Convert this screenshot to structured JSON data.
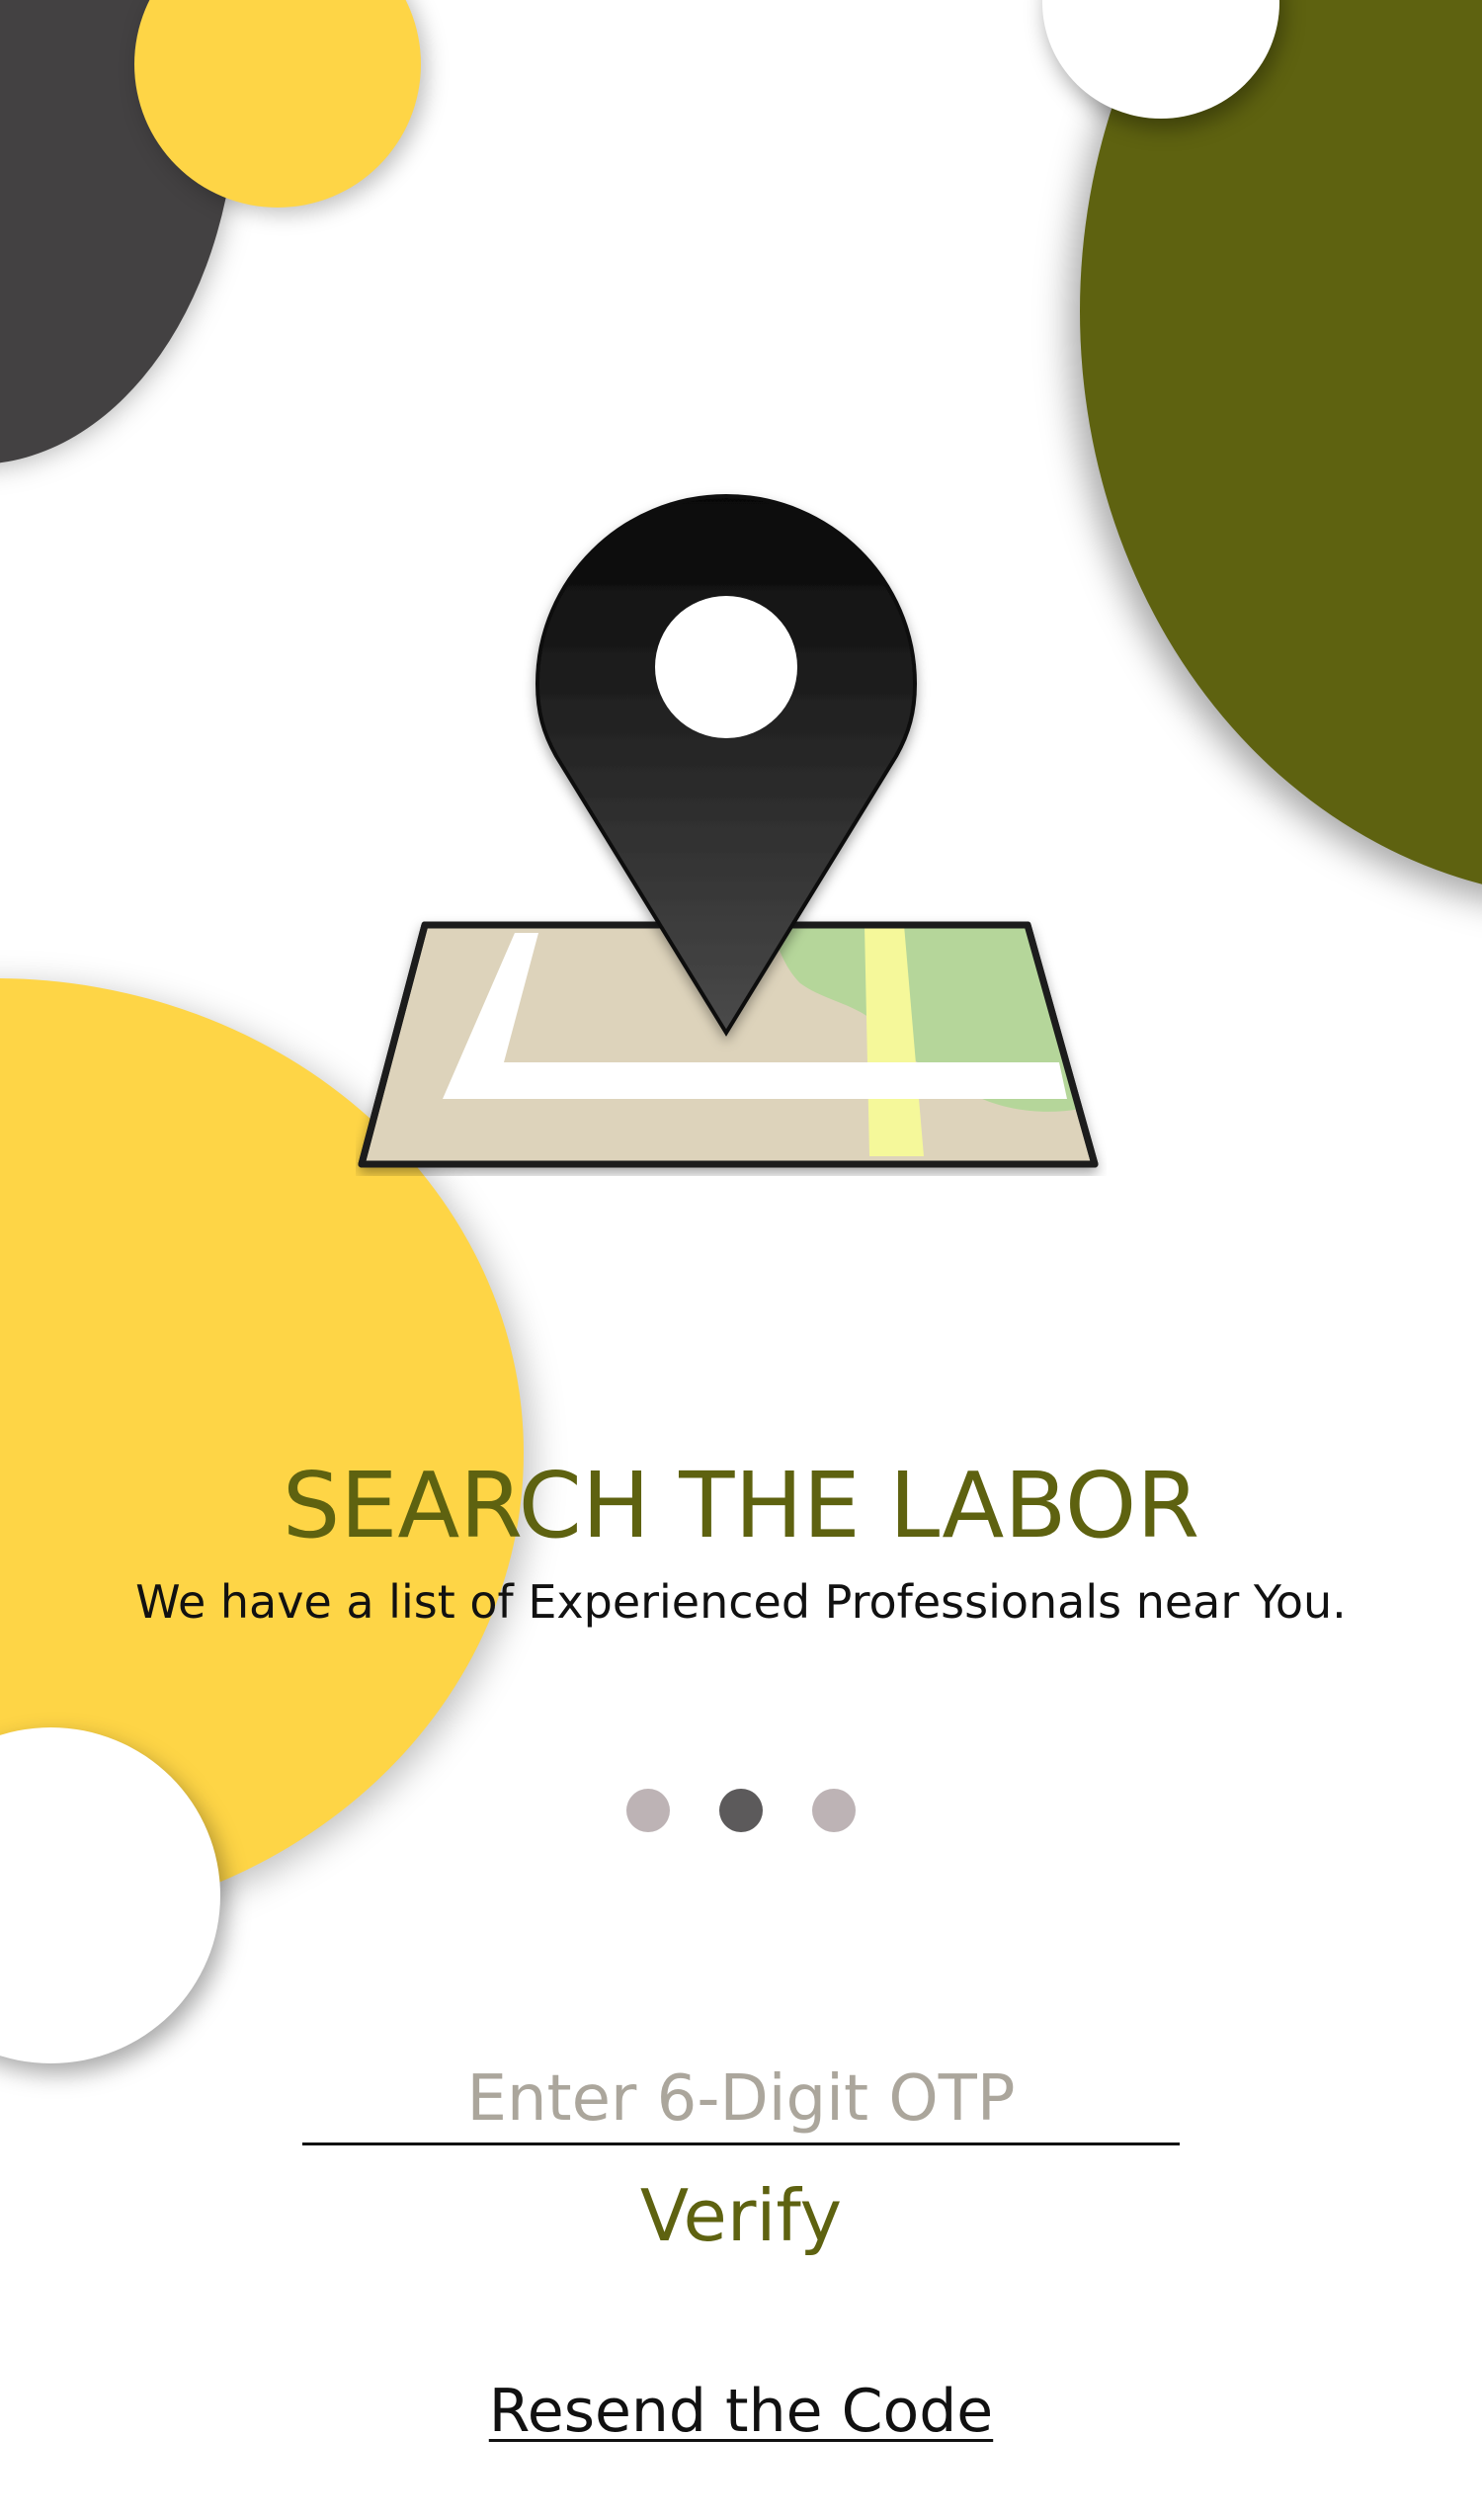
{
  "onboarding": {
    "title": "SEARCH THE LABOR",
    "subtitle": "We have a list of Experienced Professionals near You.",
    "illustration_icon": "map-location-pin-icon",
    "pagination": {
      "total": 3,
      "active_index": 1
    }
  },
  "otp": {
    "placeholder": "Enter 6-Digit OTP",
    "value": "",
    "verify_label": "Verify",
    "resend_label": "Resend the Code"
  },
  "colors": {
    "olive": "#5E6210",
    "yellow": "#FED546",
    "charcoal": "#434142",
    "dot_inactive": "#BDB3B5",
    "dot_active": "#5C5A5B",
    "placeholder": "#ABA69C"
  }
}
